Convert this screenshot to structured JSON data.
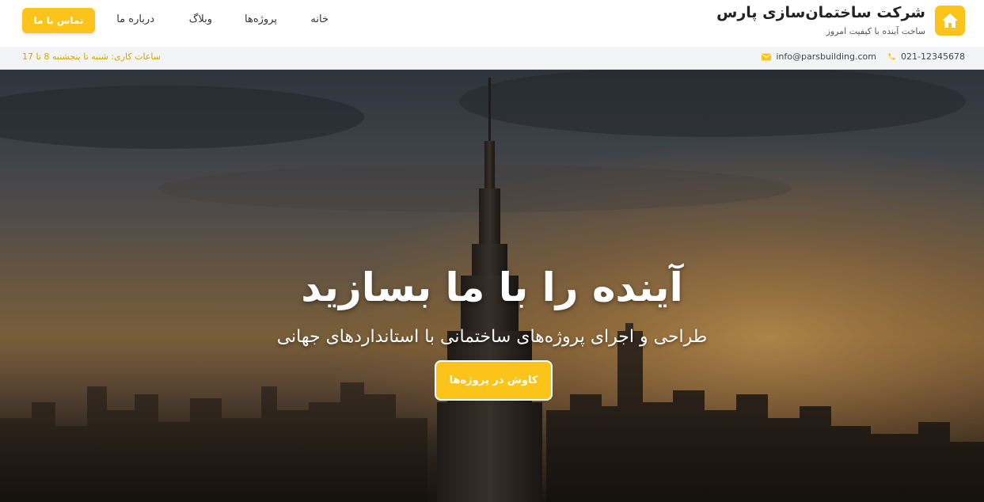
{
  "brand": {
    "title": "شرکت ساختمان‌سازی پارس",
    "tagline": "ساخت آینده با کیفیت امروز",
    "logo_icon": "home-icon"
  },
  "nav": {
    "items": [
      {
        "label": "خانه"
      },
      {
        "label": "پروژه‌ها"
      },
      {
        "label": "وبلاگ"
      },
      {
        "label": "درباره ما"
      }
    ],
    "contact_button": "تماس با ما"
  },
  "info_bar": {
    "phone": "021-12345678",
    "phone_icon": "phone-icon",
    "email": "info@parsbuilding.com",
    "email_icon": "envelope-icon",
    "hours": "ساعات کاری: شنبه تا پنجشنبه 8 تا 17"
  },
  "hero": {
    "title": "آینده را با ما بسازید",
    "subtitle": "طراحی و اجرای پروژه‌های ساختمانی با استانداردهای جهانی",
    "cta_label": "کاوش در پروژه‌ها",
    "background": "city-skyline-image"
  },
  "colors": {
    "accent": "#fcc419",
    "hours_text": "#d4a106",
    "info_bar_bg": "#f3f4f6"
  }
}
